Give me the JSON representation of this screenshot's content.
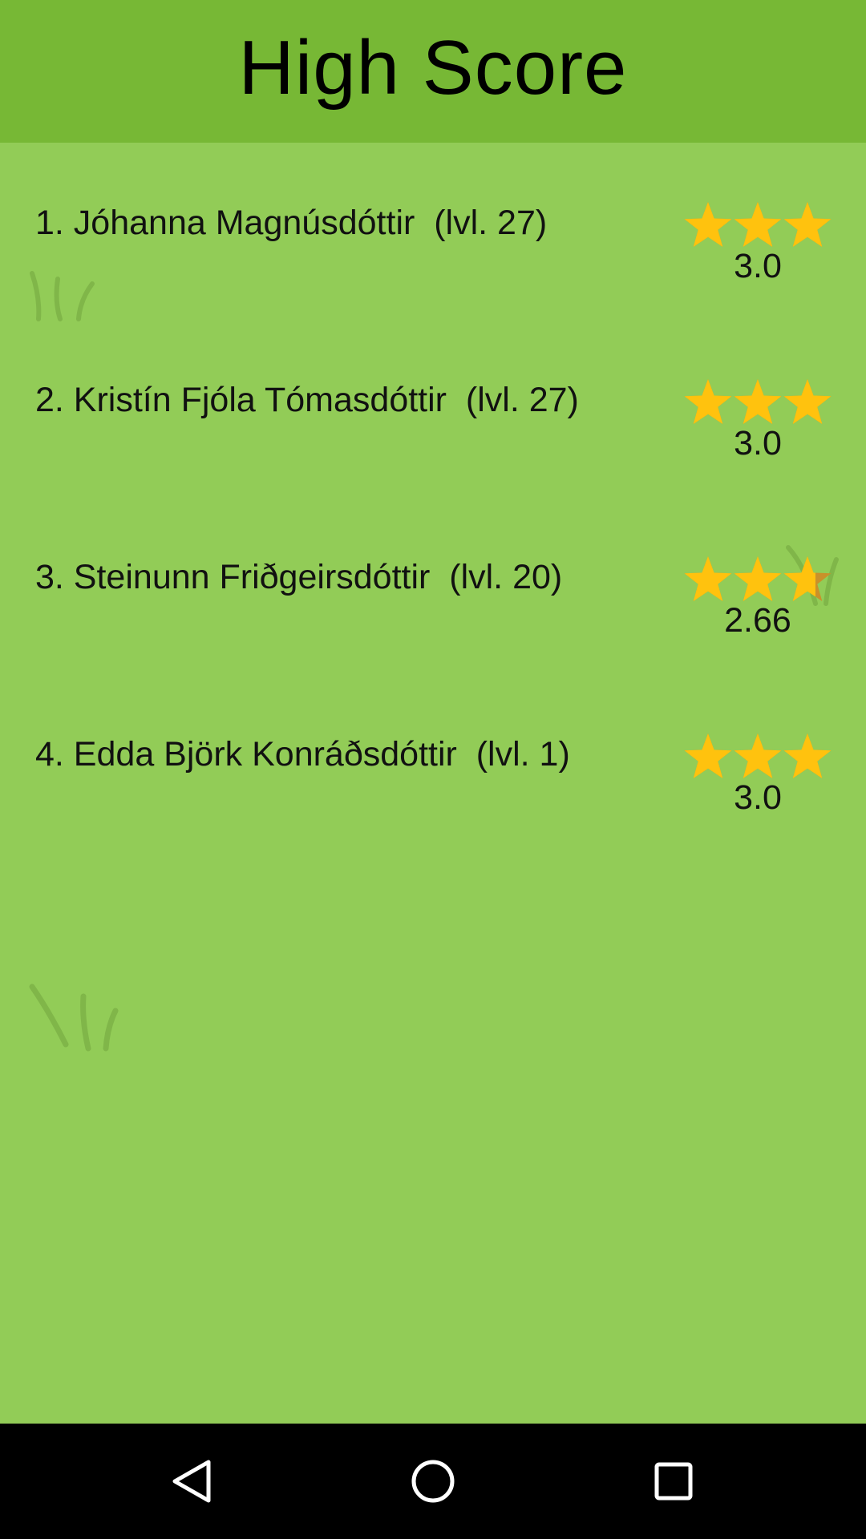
{
  "header": {
    "title": "High Score"
  },
  "scores": [
    {
      "label": "1. Jóhanna Magnúsdóttir  (lvl. 27)",
      "rating": 3.0,
      "rating_text": "3.0"
    },
    {
      "label": "2. Kristín Fjóla Tómasdóttir  (lvl. 27)",
      "rating": 3.0,
      "rating_text": "3.0"
    },
    {
      "label": "3. Steinunn Friðgeirsdóttir  (lvl. 20)",
      "rating": 2.66,
      "rating_text": "2.66"
    },
    {
      "label": "4. Edda Björk Konráðsdóttir  (lvl. 1)",
      "rating": 3.0,
      "rating_text": "3.0"
    }
  ],
  "max_stars": 3,
  "colors": {
    "header_bg": "#77b835",
    "content_bg": "#92cc57",
    "star_fill": "#ffc20e",
    "star_empty": "#c9912a",
    "navbar_bg": "#000000"
  },
  "icons": {
    "star": "star-icon",
    "back": "back-triangle-icon",
    "home": "home-circle-icon",
    "recents": "recents-square-icon",
    "decor": "grass-tuft-icon"
  }
}
